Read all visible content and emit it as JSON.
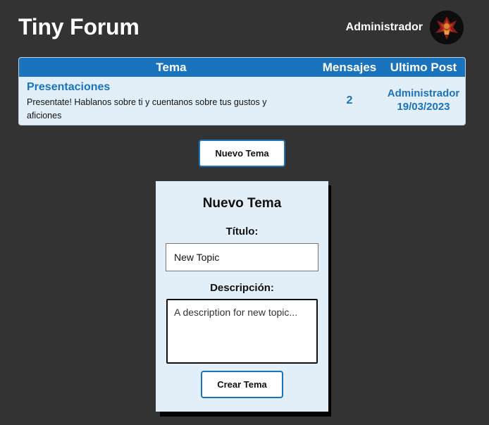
{
  "header": {
    "site_title": "Tiny Forum",
    "user_name": "Administrador",
    "avatar_icon": "user-avatar-icon"
  },
  "forum_table": {
    "columns": [
      "Tema",
      "Mensajes",
      "Ultimo Post"
    ],
    "rows": [
      {
        "title": "Presentaciones",
        "description": "Presentate! Hablanos sobre ti y cuentanos sobre tus gustos y aficiones",
        "messages": "2",
        "last_post_user": "Administrador",
        "last_post_date": "19/03/2023"
      }
    ]
  },
  "new_topic_button": "Nuevo Tema",
  "new_topic_form": {
    "heading": "Nuevo Tema",
    "title_label": "Título:",
    "title_value": "New Topic",
    "description_label": "Descripción:",
    "description_placeholder": "A description for new topic...",
    "submit_label": "Crear Tema"
  },
  "colors": {
    "background": "#333333",
    "accent": "#1a73bd",
    "panel": "#e2eff8"
  }
}
